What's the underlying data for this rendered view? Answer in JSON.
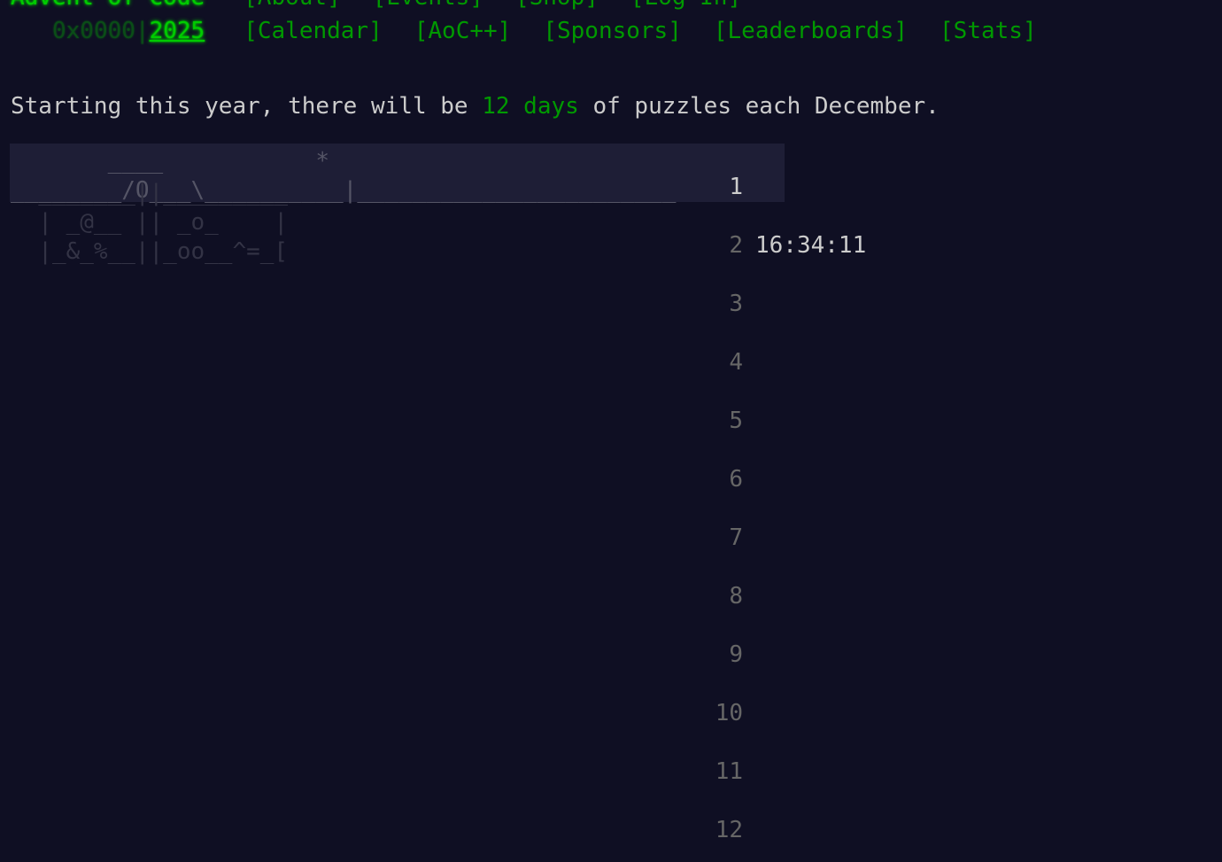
{
  "header": {
    "title": "Advent of Code",
    "nav_top": [
      "[About]",
      "[Events]",
      "[Shop]",
      "[Log In]"
    ],
    "year_prefix": "0x0000|",
    "year": "2025",
    "nav_bottom": [
      "[Calendar]",
      "[AoC++]",
      "[Sponsors]",
      "[Leaderboards]",
      "[Stats]"
    ]
  },
  "intro": {
    "before": "Starting this year, there will be ",
    "highlight": "12 days",
    "after": " of puzzles each December."
  },
  "calendar": {
    "art_day1": "       ____           *\n________/O___\\__________|_______________________",
    "art_day2": "  _______||_________\n  | _@__ || _o_    |\n  |_&_%__||_oo__^=_[",
    "countdown": "16:34:11",
    "days": [
      "1",
      "2",
      "3",
      "4",
      "5",
      "6",
      "7",
      "8",
      "9",
      "10",
      "11",
      "12"
    ]
  },
  "colors": {
    "background": "#0f0f23",
    "accent_green": "#00cc00",
    "link_green": "#009900",
    "text": "#cccccc",
    "active_row": "#1e1e36"
  }
}
